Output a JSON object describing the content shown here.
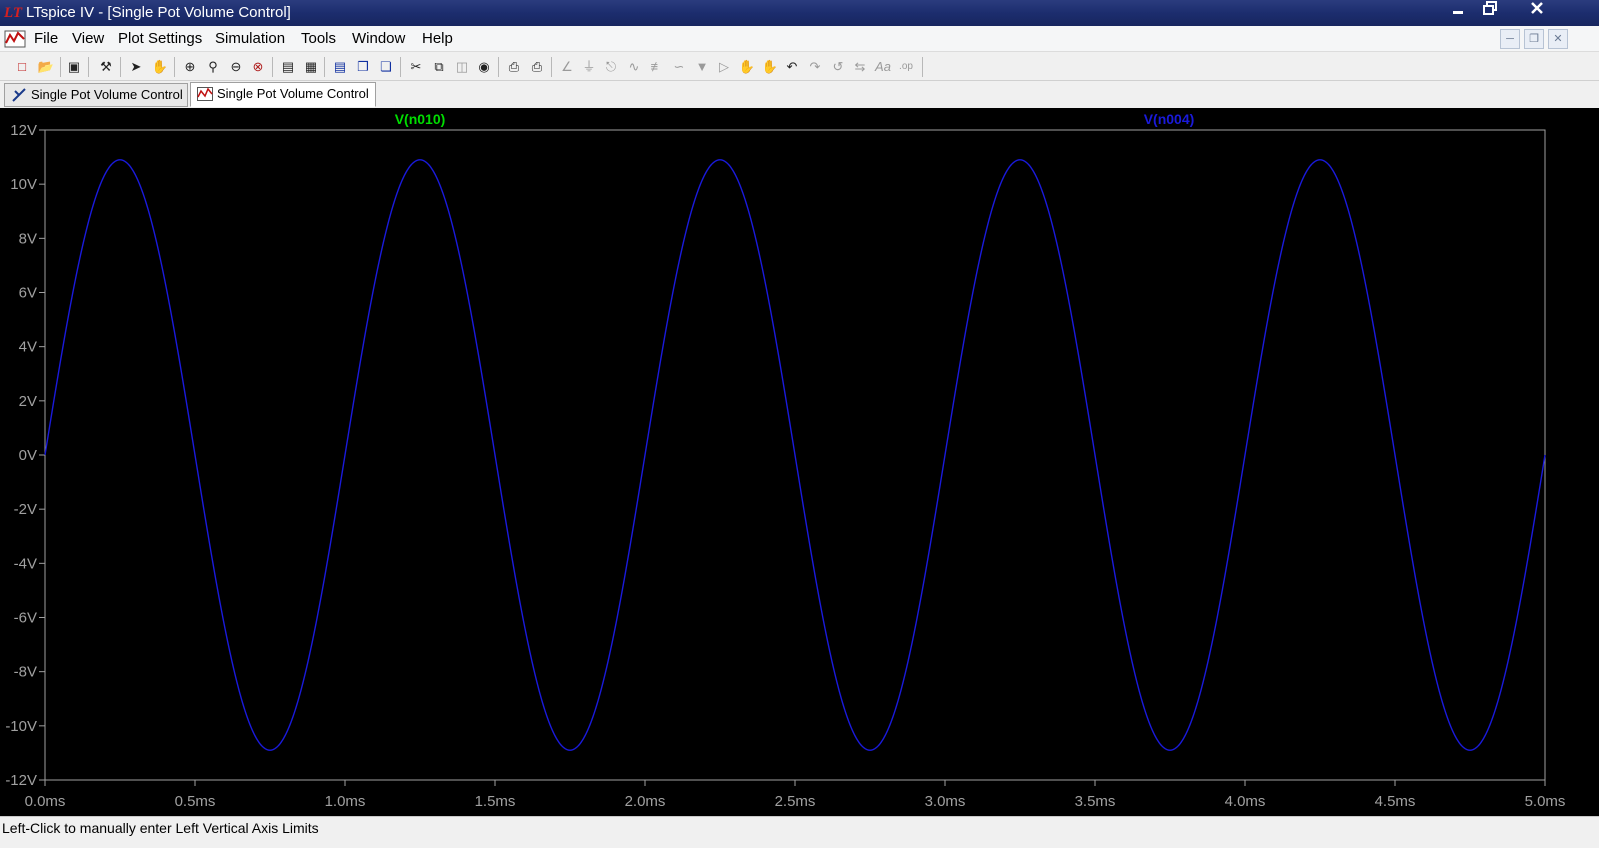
{
  "window": {
    "title": "LTspice IV - [Single Pot Volume Control]",
    "app_icon": "ltspice-logo-icon",
    "controls": [
      "minimize-icon",
      "restore-icon",
      "close-icon"
    ]
  },
  "menu": {
    "items": [
      "File",
      "View",
      "Plot Settings",
      "Simulation",
      "Tools",
      "Window",
      "Help"
    ],
    "mdi_controls": [
      "minimize-icon",
      "restore-icon",
      "close-icon"
    ]
  },
  "toolbar": {
    "icons": [
      "new-schematic-icon",
      "open-icon",
      "save-icon",
      "control-panel-icon",
      "run-icon",
      "halt-icon",
      "zoom-in-icon",
      "zoom-pan-icon",
      "zoom-out-icon",
      "zoom-fit-icon",
      "autorange-icon",
      "cursor-icon",
      "tile-horizontal-icon",
      "cascade-icon",
      "tile-vertical-icon",
      "cut-icon",
      "copy-icon",
      "paste-icon",
      "find-icon",
      "print-icon",
      "print-setup-icon",
      "wire-icon",
      "ground-icon",
      "label-icon",
      "resistor-icon",
      "capacitor-icon",
      "inductor-icon",
      "diode-icon",
      "component-icon",
      "move-icon",
      "drag-icon",
      "undo-icon",
      "redo-icon",
      "rotate-icon",
      "mirror-icon",
      "text-icon",
      "spice-directive-icon"
    ]
  },
  "tabs": [
    {
      "label": "Single Pot Volume Control",
      "icon": "schematic-icon",
      "active": false
    },
    {
      "label": "Single Pot Volume Control",
      "icon": "waveform-icon",
      "active": true
    }
  ],
  "chart_data": {
    "type": "line",
    "x_unit": "ms",
    "xlim": [
      0,
      5
    ],
    "ylim": [
      -12,
      12
    ],
    "x_ticks": [
      "0.0ms",
      "0.5ms",
      "1.0ms",
      "1.5ms",
      "2.0ms",
      "2.5ms",
      "3.0ms",
      "3.5ms",
      "4.0ms",
      "4.5ms",
      "5.0ms"
    ],
    "y_ticks": [
      "12V",
      "10V",
      "8V",
      "6V",
      "4V",
      "2V",
      "0V",
      "-2V",
      "-4V",
      "-6V",
      "-8V",
      "-10V",
      "-12V"
    ],
    "background": "#000000",
    "series": [
      {
        "name": "V(n010)",
        "color": "#00dd00",
        "amplitude": 10.9,
        "frequency_khz": 1,
        "visible_trace": false
      },
      {
        "name": "V(n004)",
        "color": "#1a1adb",
        "amplitude": 10.9,
        "frequency_khz": 1,
        "visible_trace": true
      }
    ]
  },
  "status": {
    "message": "Left-Click to manually enter Left Vertical Axis Limits"
  }
}
